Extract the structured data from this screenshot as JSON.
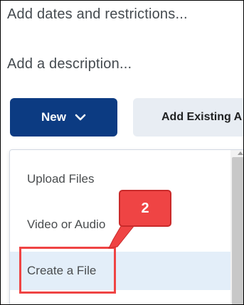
{
  "header": {
    "dates_link": "Add dates and restrictions...",
    "description_link": "Add a description..."
  },
  "toolbar": {
    "new_label": "New",
    "add_existing_label": "Add Existing A"
  },
  "menu": {
    "items": [
      {
        "label": "Upload Files"
      },
      {
        "label": "Video or Audio"
      },
      {
        "label": "Create a File",
        "selected": true
      }
    ]
  },
  "annotation": {
    "step_number": "2",
    "color": "#ef4444"
  },
  "colors": {
    "primary": "#0c3b82",
    "menu_highlight": "#e3eef9"
  }
}
